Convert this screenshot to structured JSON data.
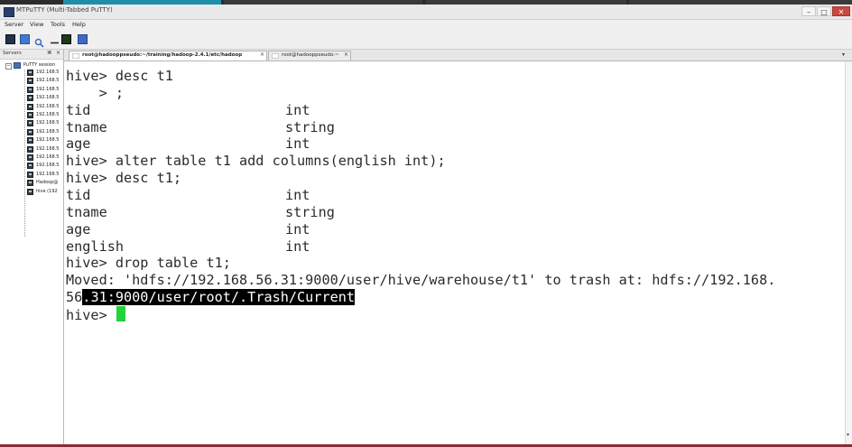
{
  "window": {
    "title": "MTPuTTY (Multi-Tabbed PuTTY)",
    "buttons": {
      "minimize": "–",
      "maximize": "□",
      "close": "✕"
    }
  },
  "menu": {
    "items": [
      "Server",
      "View",
      "Tools",
      "Help"
    ]
  },
  "toolbar": {
    "icons": [
      "server-icon",
      "folder-icon",
      "search-icon",
      "connect-icon",
      "terminal-icon",
      "save-icon"
    ]
  },
  "sidebar": {
    "title": "Servers",
    "pin": "⌘",
    "close": "×",
    "root_label": "PuTTY session",
    "items": [
      "192.168.5",
      "192.168.5",
      "192.168.5",
      "192.168.5",
      "192.168.5",
      "192.168.5",
      "192.168.5",
      "192.168.5",
      "192.168.5",
      "192.168.5",
      "192.168.5",
      "192.168.5",
      "192.168.5",
      "Hadoop@",
      "hive (192"
    ]
  },
  "tabs": [
    {
      "label": "root@hadooppseudo:~/training/hadoop-2.4.1/etc/hadoop",
      "close": "×",
      "active": true
    },
    {
      "label": "root@hadooppseudo:~",
      "close": "×",
      "active": false
    }
  ],
  "terminal": {
    "lines": [
      {
        "text": "hive> desc t1"
      },
      {
        "text": "    > ;"
      },
      {
        "text": "tid",
        "col2": "int"
      },
      {
        "text": "tname",
        "col2": "string"
      },
      {
        "text": "age",
        "col2": "int"
      },
      {
        "text": "hive> alter table t1 add columns(english int);"
      },
      {
        "text": "hive> desc t1;"
      },
      {
        "text": "tid",
        "col2": "int"
      },
      {
        "text": "tname",
        "col2": "string"
      },
      {
        "text": "age",
        "col2": "int"
      },
      {
        "text": "english",
        "col2": "int"
      },
      {
        "text": "hive> drop table t1;"
      },
      {
        "text": "Moved: 'hdfs://192.168.56.31:9000/user/hive/warehouse/t1' to trash at: hdfs://192.168."
      },
      {
        "text": "56",
        "selected": ".31:9000/user/root/.Trash/Current"
      },
      {
        "text": "hive> ",
        "cursor": true
      }
    ]
  },
  "colors": {
    "cursor": "#22d33a",
    "selection_bg": "#000000",
    "close_button": "#c9483f",
    "bottom_border": "#8b2b36"
  }
}
